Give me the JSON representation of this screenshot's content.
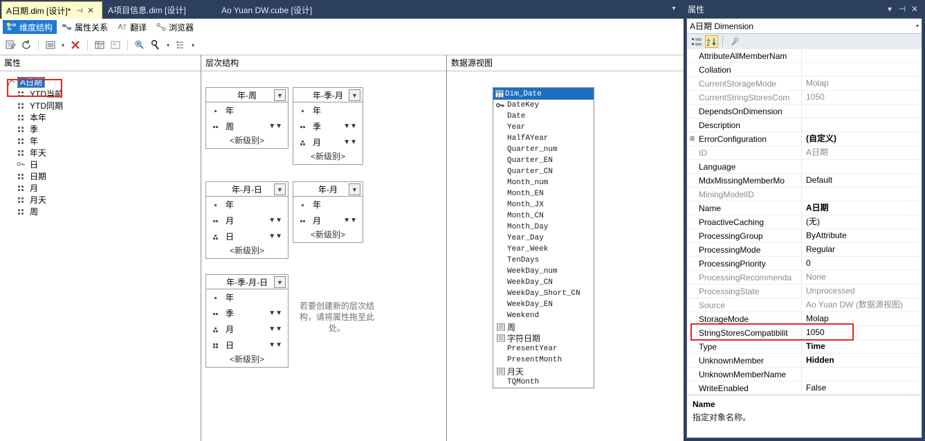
{
  "window": {
    "tabs": [
      {
        "label": "A日期.dim [设计]*",
        "active": true,
        "pin": "⊣",
        "close": "✕"
      },
      {
        "label": "A项目信息.dim [设计]",
        "active": false
      },
      {
        "label": "Ao Yuan DW.cube [设计]",
        "active": false
      }
    ],
    "tab_overflow_icon": "chevron-down-icon"
  },
  "designer_tabs": [
    {
      "label": "维度结构",
      "selected": true,
      "icon": "dimension-structure-icon"
    },
    {
      "label": "属性关系",
      "selected": false,
      "icon": "attribute-relationships-icon"
    },
    {
      "label": "翻译",
      "selected": false,
      "icon": "translations-icon"
    },
    {
      "label": "浏览器",
      "selected": false,
      "icon": "browser-icon"
    }
  ],
  "toolbar": {
    "buttons": [
      {
        "name": "edit-dimension-icon"
      },
      {
        "name": "refresh-icon"
      },
      {
        "name": "list-view-icon"
      },
      {
        "name": "list-view-dropdown-arrow"
      },
      {
        "name": "delete-icon"
      },
      {
        "name": "show-attributes-grid-icon"
      },
      {
        "name": "show-properties-icon"
      },
      {
        "name": "zoom-icon"
      },
      {
        "name": "find-icon"
      },
      {
        "name": "find-dropdown-arrow"
      },
      {
        "name": "outline-icon"
      },
      {
        "name": "outline-dropdown-arrow"
      }
    ]
  },
  "panes": {
    "attributes": {
      "header": "属性",
      "tree": [
        {
          "label": "A日期",
          "icon": "dimension-icon",
          "selected": true,
          "root": true
        },
        {
          "label": "YTD当前",
          "icon": "attribute-icon"
        },
        {
          "label": "YTD同期",
          "icon": "attribute-icon"
        },
        {
          "label": "本年",
          "icon": "attribute-icon"
        },
        {
          "label": "季",
          "icon": "attribute-icon"
        },
        {
          "label": "年",
          "icon": "attribute-icon"
        },
        {
          "label": "年天",
          "icon": "attribute-icon"
        },
        {
          "label": "日",
          "icon": "key-attribute-icon"
        },
        {
          "label": "日期",
          "icon": "attribute-icon"
        },
        {
          "label": "月",
          "icon": "attribute-icon"
        },
        {
          "label": "月天",
          "icon": "attribute-icon"
        },
        {
          "label": "周",
          "icon": "attribute-icon"
        }
      ]
    },
    "hierarchies": {
      "header": "层次结构",
      "new_level_label": "<新级别>",
      "drag_hint": "若要创建新的层次结构，请将属性拖至此处。",
      "cards": [
        {
          "title": "年-周",
          "levels": [
            {
              "label": "年",
              "depth": 1,
              "chevron": false
            },
            {
              "label": "周",
              "depth": 2,
              "chevron": true
            }
          ]
        },
        {
          "title": "年-季-月",
          "levels": [
            {
              "label": "年",
              "depth": 1,
              "chevron": false
            },
            {
              "label": "季",
              "depth": 2,
              "chevron": true
            },
            {
              "label": "月",
              "depth": 3,
              "chevron": true
            }
          ]
        },
        {
          "title": "年-月-日",
          "levels": [
            {
              "label": "年",
              "depth": 1,
              "chevron": false
            },
            {
              "label": "月",
              "depth": 2,
              "chevron": true
            },
            {
              "label": "日",
              "depth": 3,
              "chevron": true
            }
          ]
        },
        {
          "title": "年-月",
          "levels": [
            {
              "label": "年",
              "depth": 1,
              "chevron": false
            },
            {
              "label": "月",
              "depth": 2,
              "chevron": true
            }
          ]
        },
        {
          "title": "年-季-月-日",
          "levels": [
            {
              "label": "年",
              "depth": 1,
              "chevron": false
            },
            {
              "label": "季",
              "depth": 2,
              "chevron": true
            },
            {
              "label": "月",
              "depth": 3,
              "chevron": true
            },
            {
              "label": "日",
              "depth": 4,
              "chevron": true
            }
          ]
        }
      ]
    },
    "data_source_view": {
      "header": "数据源视图",
      "table": {
        "name": "Dim_Date",
        "icon": "table-icon",
        "columns": [
          {
            "label": "DateKey",
            "icon": "primary-key-icon"
          },
          {
            "label": "Date",
            "icon": ""
          },
          {
            "label": "Year",
            "icon": ""
          },
          {
            "label": "HalfAYear",
            "icon": ""
          },
          {
            "label": "Quarter_num",
            "icon": ""
          },
          {
            "label": "Quarter_EN",
            "icon": ""
          },
          {
            "label": "Quarter_CN",
            "icon": ""
          },
          {
            "label": "Month_num",
            "icon": ""
          },
          {
            "label": "Month_EN",
            "icon": ""
          },
          {
            "label": "Month_JX",
            "icon": ""
          },
          {
            "label": "Month_CN",
            "icon": ""
          },
          {
            "label": "Month_Day",
            "icon": ""
          },
          {
            "label": "Year_Day",
            "icon": ""
          },
          {
            "label": "Year_Week",
            "icon": ""
          },
          {
            "label": "TenDays",
            "icon": ""
          },
          {
            "label": "WeekDay_num",
            "icon": ""
          },
          {
            "label": "WeekDay_CN",
            "icon": ""
          },
          {
            "label": "WeekDay_Short_CN",
            "icon": ""
          },
          {
            "label": "WeekDay_EN",
            "icon": ""
          },
          {
            "label": "Weekend",
            "icon": ""
          },
          {
            "label": "周",
            "icon": "calculated-column-icon",
            "cjk": true
          },
          {
            "label": "字符日期",
            "icon": "calculated-column-icon",
            "cjk": true
          },
          {
            "label": "PresentYear",
            "icon": ""
          },
          {
            "label": "PresentMonth",
            "icon": ""
          },
          {
            "label": "月天",
            "icon": "calculated-column-icon",
            "cjk": true
          },
          {
            "label": "TQMonth",
            "icon": ""
          }
        ]
      }
    }
  },
  "properties": {
    "title": "属性",
    "window_buttons": [
      {
        "name": "dropdown-icon",
        "glyph": "▾"
      },
      {
        "name": "pin-icon",
        "glyph": "⊣"
      },
      {
        "name": "close-icon",
        "glyph": "✕"
      }
    ],
    "object": "A日期 Dimension",
    "toolbar": [
      {
        "name": "categorized-button",
        "active": false
      },
      {
        "name": "alphabetical-button",
        "active": true
      },
      {
        "name": "property-pages-button",
        "active": false
      }
    ],
    "rows": [
      {
        "key": "AttributeAllMemberNam",
        "value": "",
        "readonly": false,
        "expandable": false,
        "bold": false
      },
      {
        "key": "Collation",
        "value": "",
        "readonly": false,
        "expandable": false,
        "bold": false
      },
      {
        "key": "CurrentStorageMode",
        "value": "Molap",
        "readonly": true,
        "expandable": false,
        "bold": false
      },
      {
        "key": "CurrentStringStoresCom",
        "value": "1050",
        "readonly": true,
        "expandable": false,
        "bold": false
      },
      {
        "key": "DependsOnDimension",
        "value": "",
        "readonly": false,
        "expandable": false,
        "bold": false
      },
      {
        "key": "Description",
        "value": "",
        "readonly": false,
        "expandable": false,
        "bold": false
      },
      {
        "key": "ErrorConfiguration",
        "value": "(自定义)",
        "readonly": false,
        "expandable": true,
        "bold": true
      },
      {
        "key": "ID",
        "value": "A日期",
        "readonly": true,
        "expandable": false,
        "bold": false
      },
      {
        "key": "Language",
        "value": "",
        "readonly": false,
        "expandable": false,
        "bold": false
      },
      {
        "key": "MdxMissingMemberMo",
        "value": "Default",
        "readonly": false,
        "expandable": false,
        "bold": false
      },
      {
        "key": "MiningModelID",
        "value": "",
        "readonly": true,
        "expandable": false,
        "bold": false
      },
      {
        "key": "Name",
        "value": "A日期",
        "readonly": false,
        "expandable": false,
        "bold": true
      },
      {
        "key": "ProactiveCaching",
        "value": "(无)",
        "readonly": false,
        "expandable": false,
        "bold": false
      },
      {
        "key": "ProcessingGroup",
        "value": "ByAttribute",
        "readonly": false,
        "expandable": false,
        "bold": false
      },
      {
        "key": "ProcessingMode",
        "value": "Regular",
        "readonly": false,
        "expandable": false,
        "bold": false
      },
      {
        "key": "ProcessingPriority",
        "value": "0",
        "readonly": false,
        "expandable": false,
        "bold": false
      },
      {
        "key": "ProcessingRecommenda",
        "value": "None",
        "readonly": true,
        "expandable": false,
        "bold": false
      },
      {
        "key": "ProcessingState",
        "value": "Unprocessed",
        "readonly": true,
        "expandable": false,
        "bold": false
      },
      {
        "key": "Source",
        "value": "Ao Yuan DW (数据源视图)",
        "readonly": true,
        "expandable": false,
        "bold": false
      },
      {
        "key": "StorageMode",
        "value": "Molap",
        "readonly": false,
        "expandable": false,
        "bold": false
      },
      {
        "key": "StringStoresCompatibilit",
        "value": "1050",
        "readonly": false,
        "expandable": false,
        "bold": false
      },
      {
        "key": "Type",
        "value": "Time",
        "readonly": false,
        "expandable": false,
        "bold": true
      },
      {
        "key": "UnknownMember",
        "value": "Hidden",
        "readonly": false,
        "expandable": false,
        "bold": true
      },
      {
        "key": "UnknownMemberName",
        "value": "",
        "readonly": false,
        "expandable": false,
        "bold": false
      },
      {
        "key": "WriteEnabled",
        "value": "False",
        "readonly": false,
        "expandable": false,
        "bold": false
      }
    ],
    "description": {
      "title": "Name",
      "text": "指定对象名称。"
    }
  },
  "annotations": {
    "highlight_color": "#e8261a",
    "boxes": [
      {
        "name": "attribute-root-highlight",
        "target": "A日期"
      },
      {
        "name": "type-property-highlight",
        "target": "Type = Time"
      }
    ]
  }
}
